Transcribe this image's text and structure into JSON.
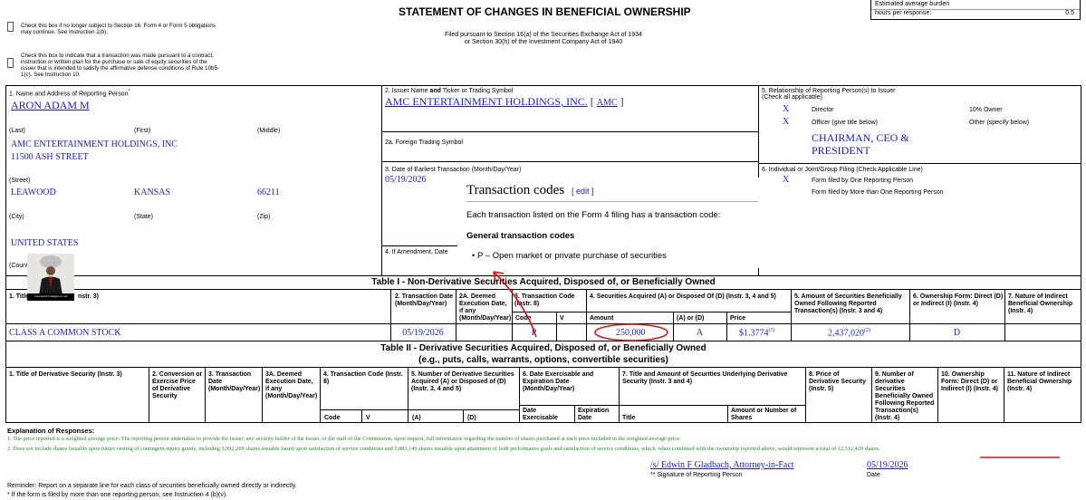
{
  "header": {
    "burden_title": "Estimated average burden",
    "burden_label": "hours per response:",
    "burden_value": "0.5",
    "title": "STATEMENT OF CHANGES IN BENEFICIAL OWNERSHIP",
    "filed_line1": "Filed pursuant to Section 16(a) of the Securities Exchange Act of 1934",
    "filed_line2": "or Section 30(h) of the Investment Company Act of 1940",
    "check1": "Check this box if no longer subject to Section 16. Form 4 or Form 5 obligations may continue. See Instruction 1(b).",
    "check2": "Check this box to indicate that a transaction was made pursuant to a contract, instruction or written plan for the purchase or sale of equity securities of the issuer that is intended to satisfy the affirmative defense conditions of Rule 10b5-1(c). See Instruction 10."
  },
  "reporting_person": {
    "section_label": "1. Name and Address of Reporting Person",
    "section_mark": "*",
    "name": "ARON ADAM M",
    "last_label": "(Last)",
    "first_label": "(First)",
    "middle_label": "(Middle)",
    "company": "AMC ENTERTAINMENT HOLDINGS, INC",
    "street_value": "11500 ASH STREET",
    "street_label": "(Street)",
    "city": "LEAWOOD",
    "state": "KANSAS",
    "zip": "66211",
    "city_label": "(City)",
    "state_label": "(State)",
    "zip_label": "(Zip)",
    "country": "UNITED STATES",
    "country_label": "(Count"
  },
  "issuer": {
    "label": "2. Issuer Name",
    "label_and": "and",
    "label_rest": "Ticker or Trading Symbol",
    "name": "AMC ENTERTAINMENT HOLDINGS, INC.",
    "ticker": "AMC",
    "foreign_label": "2a. Foreign Trading Symbol",
    "date_label": "3. Date of Earliest Transaction (Month/Day/Year)",
    "date_value": "05/19/2026",
    "amend_label": "4. If Amendment, Date"
  },
  "relationship": {
    "label": "5. Relationship of Reporting Person(s) to Issuer",
    "sub": "(Check all applicable)",
    "director_mark": "X",
    "director": "Director",
    "ten_pct": "10% Owner",
    "officer_mark": "X",
    "officer": "Officer (give title below)",
    "other": "Other (specify below)",
    "title_line1": "CHAIRMAN, CEO &",
    "title_line2": "PRESIDENT",
    "filing_label": "6. Individual or Joint/Group Filing (Check Applicable Line)",
    "one_mark": "X",
    "one_person": "Form filed by One Reporting Person",
    "more_person": "Form filed by More than One Reporting Person"
  },
  "popup": {
    "title": "Transaction codes",
    "edit": "[ edit ]",
    "desc": "Each transaction listed on the Form 4 filing has a transaction code:",
    "subtitle": "General transaction codes",
    "bullet": "P – Open market or private purchase of securities"
  },
  "table1": {
    "title": "Table I - Non-Derivative Securities Acquired, Disposed of, or Beneficially Owned",
    "col1": "1. Title",
    "col1b": "nstr. 3)",
    "col2": "2. Transaction Date (Month/Day/Year)",
    "col2a": "2A. Deemed Execution Date, if any (Month/Day/Year)",
    "col3": "3. Transaction Code (Instr. 8)",
    "col3_code": "Code",
    "col3_v": "V",
    "col4": "4. Securities Acquired (A) or Disposed Of (D) (Instr. 3, 4 and 5)",
    "col4_amount": "Amount",
    "col4_ad": "(A) or (D)",
    "col4_price": "Price",
    "col5": "5. Amount of Securities Beneficially Owned Following Reported Transaction(s) (Instr. 3 and 4)",
    "col6": "6. Ownership Form: Direct (D) or Indirect (I) (Instr. 4)",
    "col7": "7. Nature of Indirect Beneficial Ownership (Instr. 4)",
    "row": {
      "title": "CLASS A COMMON STOCK",
      "date": "05/19/2026",
      "code": "P",
      "amount": "250,000",
      "ad": "A",
      "price": "$1.3774",
      "price_fn": "(1)",
      "owned": "2,437,020",
      "owned_fn": "(2)",
      "form": "D"
    }
  },
  "table2": {
    "title": "Table II - Derivative Securities Acquired, Disposed of, or Beneficially Owned",
    "subtitle": "(e.g., puts, calls, warrants, options, convertible securities)",
    "c1": "1. Title of Derivative Security (Instr. 3)",
    "c2": "2. Conversion or Exercise Price of Derivative Security",
    "c3": "3. Transaction Date (Month/Day/Year)",
    "c3a": "3A. Deemed Execution Date, if any (Month/Day/Year)",
    "c4": "4. Transaction Code (Instr. 8)",
    "c5": "5. Number of Derivative Securities Acquired (A) or Disposed of (D) (Instr. 3, 4 and 5)",
    "c6": "6. Date Exercisable and Expiration Date (Month/Day/Year)",
    "c7": "7. Title and Amount of Securities Underlying Derivative Security (Instr. 3 and 4)",
    "c8": "8. Price of Derivative Security (Instr. 5)",
    "c9": "9. Number of derivative Securities Beneficially Owned Following Reported Transaction(s) (Instr. 4)",
    "c10": "10. Ownership Form: Direct (D) or Indirect (I) (Instr. 4)",
    "c11": "11. Nature of Indirect Beneficial Ownership (Instr. 4)",
    "s_code": "Code",
    "s_v": "V",
    "s_a": "(A)",
    "s_d": "(D)",
    "s_exer": "Date Exercisable",
    "s_exp": "Expiration Date",
    "s_title": "Title",
    "s_amount": "Amount or Number of Shares"
  },
  "explanation": {
    "heading": "Explanation of Responses:",
    "fn1": "1. The price reported is a weighted average price. The reporting person undertakes to provide the Issuer, any security holder of the Issuer, or the staff of the Commission, upon request, full information regarding the number of shares purchased at each price included in the weighted average price.",
    "fn2": "2. Does not include shares issuable upon future vesting of contingent equity grants, including 3,992,269 shares issuable based upon satisfaction of service conditions and 5,883,140 shares issuable upon attainment of both performance goals and satisfaction of service conditions, which, when combined with the ownership reported above, would represent a total of 12,312,429 shares."
  },
  "signature": {
    "name": "/s/ Edwin F Gladbach, Attorney-in-Fact",
    "name_label": "** Signature of Reporting Person",
    "date": "05/19/2026",
    "date_label": "Date"
  },
  "footer": {
    "reminder": "Reminder: Report on a separate line for each class of securities beneficially owned directly or indirectly.",
    "note": "* If the form is filed by more than one reporting person, see Instruction 4 (b)(v)."
  },
  "overlay": {
    "avatar_caption": "Counterfeit Intelligence Lab"
  },
  "colors": {
    "link": "#1a1ad6",
    "annotation_red": "#e01010",
    "footnote_green": "#1f8c1f"
  }
}
